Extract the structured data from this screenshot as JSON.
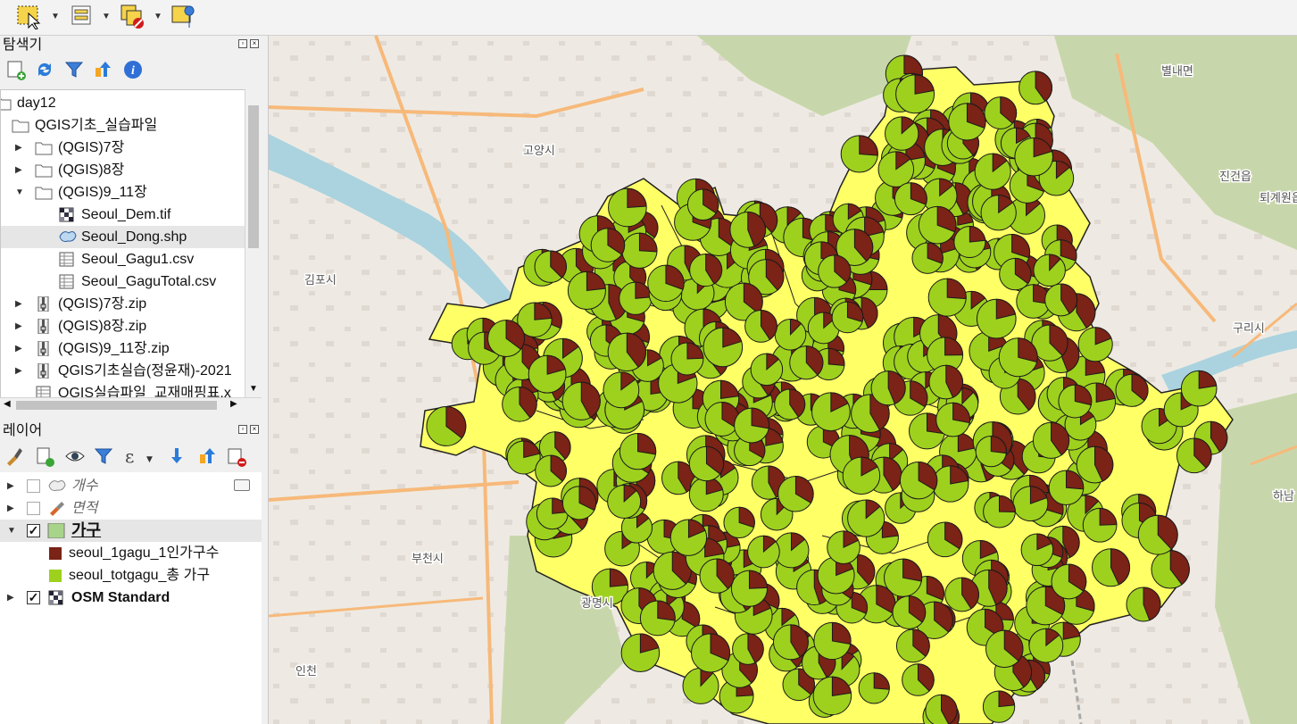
{
  "toolbar": {
    "icons": [
      "select-features-icon",
      "attribute-table-icon",
      "deselect-features-icon",
      "identify-features-icon"
    ]
  },
  "browser_panel": {
    "title": "탐색기",
    "tools": [
      "add-layer-icon",
      "refresh-icon",
      "filter-icon",
      "collapse-icon",
      "info-icon"
    ],
    "items": [
      {
        "label": "day12",
        "indent": 0,
        "icon": "folder-icon",
        "expander": ""
      },
      {
        "label": "QGIS기초_실습파일",
        "indent": 1,
        "icon": "folder-icon",
        "expander": ""
      },
      {
        "label": "(QGIS)7장",
        "indent": 2,
        "icon": "folder-icon",
        "expander": "▶"
      },
      {
        "label": "(QGIS)8장",
        "indent": 2,
        "icon": "folder-icon",
        "expander": "▶"
      },
      {
        "label": "(QGIS)9_11장",
        "indent": 2,
        "icon": "folder-icon",
        "expander": "▼"
      },
      {
        "label": "Seoul_Dem.tif",
        "indent": 3,
        "icon": "raster-icon",
        "expander": ""
      },
      {
        "label": "Seoul_Dong.shp",
        "indent": 3,
        "icon": "polygon-icon",
        "expander": ""
      },
      {
        "label": "Seoul_Gagu1.csv",
        "indent": 3,
        "icon": "table-icon",
        "expander": ""
      },
      {
        "label": "Seoul_GaguTotal.csv",
        "indent": 3,
        "icon": "table-icon",
        "expander": ""
      },
      {
        "label": "(QGIS)7장.zip",
        "indent": 2,
        "icon": "zip-icon",
        "expander": "▶"
      },
      {
        "label": "(QGIS)8장.zip",
        "indent": 2,
        "icon": "zip-icon",
        "expander": "▶"
      },
      {
        "label": "(QGIS)9_11장.zip",
        "indent": 2,
        "icon": "zip-icon",
        "expander": "▶"
      },
      {
        "label": "QGIS기초실습(정윤재)-2021",
        "indent": 2,
        "icon": "zip-icon",
        "expander": "▶"
      },
      {
        "label": "QGIS실습파일_교재매핑표.x",
        "indent": 2,
        "icon": "table-icon",
        "expander": ""
      }
    ],
    "selected_index": 6
  },
  "layers_panel": {
    "title": "레이어",
    "layers": [
      {
        "label": "개수",
        "checked": false,
        "italic": true,
        "bold": false,
        "expander": "▶",
        "icon": "polygon-layer-icon"
      },
      {
        "label": "면적",
        "checked": false,
        "italic": true,
        "bold": false,
        "expander": "▶",
        "icon": "style-layer-icon"
      },
      {
        "label": "가구",
        "checked": true,
        "italic": false,
        "bold": true,
        "expander": "▼",
        "icon": "fill-layer-icon"
      },
      {
        "label": "OSM Standard",
        "checked": true,
        "italic": false,
        "bold": true,
        "expander": "▶",
        "icon": "raster-layer-icon"
      }
    ],
    "legend": [
      {
        "label": "seoul_1gagu_1인가구수",
        "color": "#7a2316"
      },
      {
        "label": "seoul_totgagu_총 가구",
        "color": "#9ed11e"
      }
    ]
  },
  "map": {
    "place_labels": [
      "고양시",
      "김포시",
      "부천시",
      "광명시",
      "구리시",
      "퇴계원읍",
      "진건읍",
      "별내면",
      "하남",
      "인천"
    ],
    "colors": {
      "region_fill": "#ffff66",
      "pie_main": "#9ed11e",
      "pie_slice": "#7a2316",
      "road": "#f7b97a",
      "water": "#aad3df",
      "forest": "#c8d7ab"
    }
  }
}
